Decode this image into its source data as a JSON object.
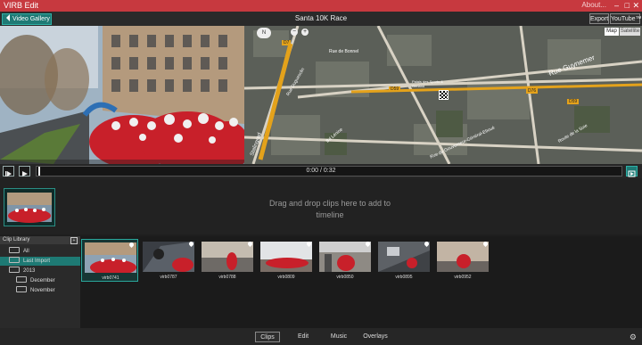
{
  "app": {
    "title": "VIRB Edit",
    "about": "About..."
  },
  "toolbar": {
    "back_label": "Video Gallery",
    "project_title": "Santa 10K Race",
    "export_label": "Export",
    "youtube_label": "YouTube™"
  },
  "map": {
    "mode_map": "Map",
    "mode_satellite": "Satellite",
    "nav_label": "N",
    "roads": [
      "D7",
      "D59",
      "D76",
      "D59"
    ],
    "labels": [
      "Rue Guynemer",
      "Rue Duguesclin",
      "Bd Lénine",
      "Rue de Bonnel",
      "Palais des Sports & Gerland",
      "Route de la Soie",
      "Rue du Gouverneur-Général-Eboué",
      "Stalingrad"
    ]
  },
  "playback": {
    "time": "0:00 / 0:32"
  },
  "timeline": {
    "drop_text": "Drag and drop clips here to add to timeline"
  },
  "library": {
    "header": "Clip Library",
    "items": [
      {
        "label": "All"
      },
      {
        "label": "Last Import"
      },
      {
        "label": "2013"
      },
      {
        "label": "December"
      },
      {
        "label": "November"
      }
    ]
  },
  "clips": [
    {
      "name": "virb0741"
    },
    {
      "name": "virb0787"
    },
    {
      "name": "virb0788"
    },
    {
      "name": "virb0809"
    },
    {
      "name": "virb0850"
    },
    {
      "name": "virb0895"
    },
    {
      "name": "virb0952"
    }
  ],
  "tabs": [
    {
      "label": "Clips"
    },
    {
      "label": "Edit"
    },
    {
      "label": "Music"
    },
    {
      "label": "Overlays"
    }
  ],
  "colors": {
    "title_bar": "#c7393f",
    "accent": "#1f7a75"
  }
}
